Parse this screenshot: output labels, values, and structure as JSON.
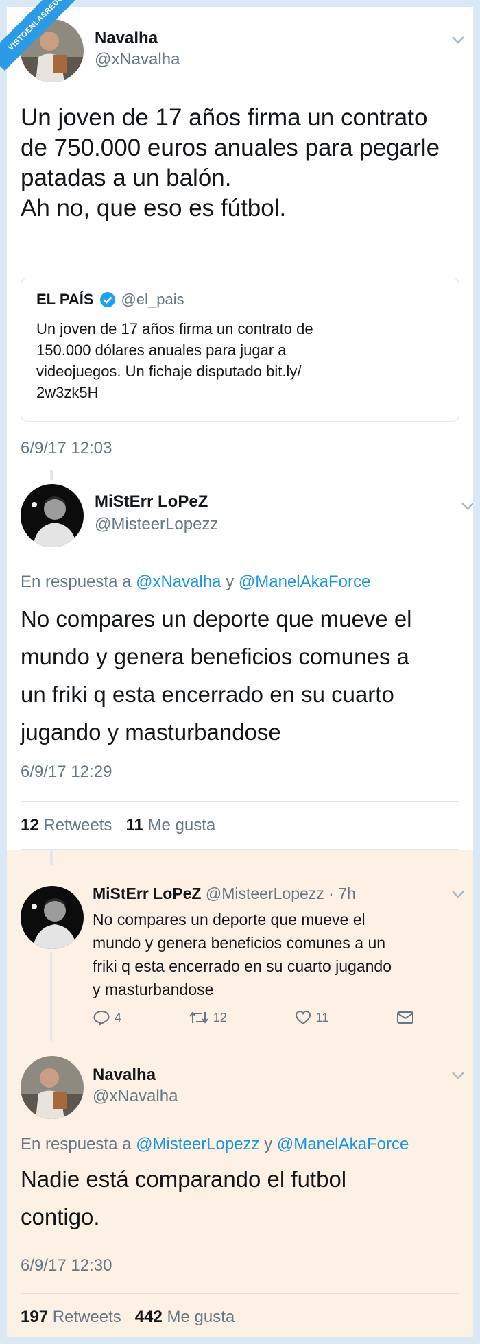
{
  "watermark": "VISTOENLASREDES",
  "tweet1": {
    "name": "Navalha",
    "handle": "@xNavalha",
    "text_lines": [
      "Un joven de 17 años firma un contrato",
      "de 750.000 euros anuales para pegarle",
      "patadas a un balón.",
      "Ah no, que eso es fútbol."
    ],
    "quote": {
      "name": "EL PAÍS",
      "handle": "@el_pais",
      "text_lines": [
        "Un joven de 17 años firma un contrato de",
        "150.000 dólares anuales para jugar a",
        "videojuegos. Un fichaje disputado bit.ly/",
        "2w3zk5H"
      ]
    },
    "timestamp": "6/9/17 12:03"
  },
  "tweet2": {
    "name": "MiStErr LoPeZ",
    "handle": "@MisteerLopezz",
    "reply_prefix": "En respuesta a",
    "reply_user1": "@xNavalha",
    "reply_joiner": "y",
    "reply_user2": "@ManelAkaForce",
    "text_lines": [
      "No compares un deporte que mueve el",
      "mundo y genera beneficios comunes a",
      "un friki q esta encerrado en su cuarto",
      "jugando y masturbandose"
    ],
    "timestamp": "6/9/17 12:29",
    "retweets_count": "12",
    "retweets_label": "Retweets",
    "likes_count": "11",
    "likes_label": "Me gusta"
  },
  "tweet3": {
    "name": "MiStErr LoPeZ",
    "handle_time": "@MisteerLopezz · 7h",
    "text_lines": [
      "No compares un deporte que mueve el",
      "mundo y genera beneficios comunes a un",
      "friki q esta encerrado en su cuarto jugando",
      "y masturbandose"
    ],
    "replies": "4",
    "retweets": "12",
    "likes": "11"
  },
  "tweet4": {
    "name": "Navalha",
    "handle": "@xNavalha",
    "reply_prefix": "En respuesta a",
    "reply_user1": "@MisteerLopezz",
    "reply_joiner": "y",
    "reply_user2": "@ManelAkaForce",
    "text_lines": [
      "Nadie está comparando el futbol",
      "contigo."
    ],
    "timestamp": "6/9/17 12:30",
    "retweets_count": "197",
    "retweets_label": "Retweets",
    "likes_count": "442",
    "likes_label": "Me gusta"
  },
  "colors": {
    "link": "#1b95e0",
    "muted": "#657786",
    "text": "#14171a",
    "reply_bg": "#fdf1e5"
  }
}
